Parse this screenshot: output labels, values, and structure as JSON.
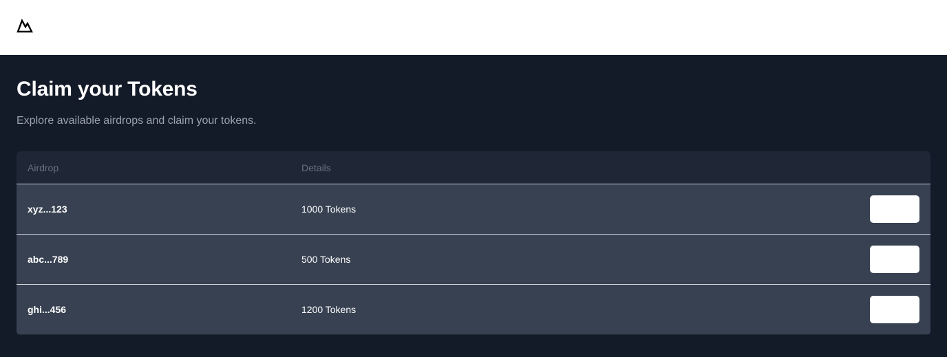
{
  "header": {
    "logo_icon": "mountain-logo-icon"
  },
  "main": {
    "title": "Claim your Tokens",
    "subtitle": "Explore available airdrops and claim your tokens."
  },
  "table": {
    "columns": [
      "Airdrop",
      "Details"
    ],
    "rows": [
      {
        "airdrop": "xyz...123",
        "details": "1000 Tokens",
        "action_label": ""
      },
      {
        "airdrop": "abc...789",
        "details": "500 Tokens",
        "action_label": ""
      },
      {
        "airdrop": "ghi...456",
        "details": "1200 Tokens",
        "action_label": ""
      }
    ]
  },
  "colors": {
    "header_bg": "#ffffff",
    "page_bg": "#131a28",
    "table_bg": "#1f2636",
    "row_bg": "#374151",
    "divider": "#d1d5db",
    "muted_text": "#9ca3af",
    "button_bg": "#ffffff"
  }
}
